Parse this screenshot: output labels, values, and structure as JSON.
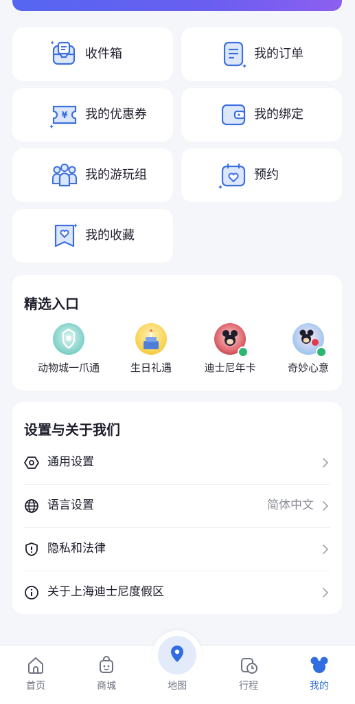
{
  "colors": {
    "accent": "#2f6de1",
    "icon_blue": "#3b6fe0",
    "icon_light": "#dce7fb",
    "background": "#f5f6f9"
  },
  "features": [
    {
      "label": "收件箱",
      "icon": "inbox-icon"
    },
    {
      "label": "我的订单",
      "icon": "order-icon"
    },
    {
      "label": "我的优惠券",
      "icon": "coupon-icon"
    },
    {
      "label": "我的绑定",
      "icon": "wallet-binding-icon"
    },
    {
      "label": "我的游玩组",
      "icon": "group-icon"
    },
    {
      "label": "预约",
      "icon": "calendar-heart-icon"
    },
    {
      "label": "我的收藏",
      "icon": "bookmark-heart-icon"
    }
  ],
  "featured": {
    "title": "精选入口",
    "entries": [
      {
        "label": "动物城一爪通",
        "icon": "zootopia-avatar"
      },
      {
        "label": "生日礼遇",
        "icon": "birthday-cake-avatar"
      },
      {
        "label": "迪士尼年卡",
        "icon": "annual-pass-avatar"
      },
      {
        "label": "奇妙心意",
        "icon": "mickey-minnie-avatar"
      }
    ]
  },
  "settings": {
    "title": "设置与关于我们",
    "rows": [
      {
        "label": "通用设置",
        "value": "",
        "icon": "hexagon-settings-icon"
      },
      {
        "label": "语言设置",
        "value": "简体中文",
        "icon": "globe-icon"
      },
      {
        "label": "隐私和法律",
        "value": "",
        "icon": "shield-icon"
      },
      {
        "label": "关于上海迪士尼度假区",
        "value": "",
        "icon": "info-icon"
      }
    ]
  },
  "bottom_nav": [
    {
      "label": "首页",
      "icon": "home-icon",
      "active": false
    },
    {
      "label": "商城",
      "icon": "shop-bag-icon",
      "active": false
    },
    {
      "label": "地图",
      "icon": "map-pin-icon",
      "active": false
    },
    {
      "label": "行程",
      "icon": "itinerary-clock-icon",
      "active": false
    },
    {
      "label": "我的",
      "icon": "mickey-head-icon",
      "active": true
    }
  ]
}
